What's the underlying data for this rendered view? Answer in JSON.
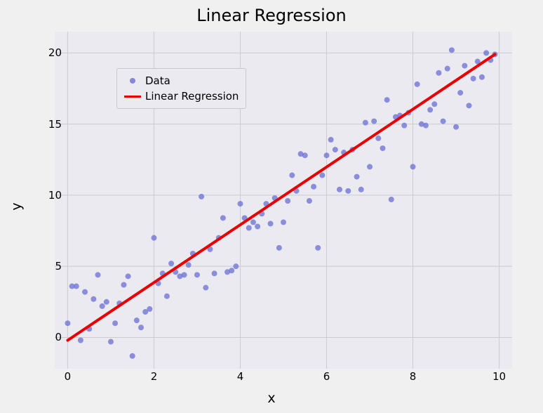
{
  "chart_data": {
    "type": "scatter",
    "title": "Linear Regression",
    "xlabel": "x",
    "ylabel": "y",
    "xlim": [
      -0.3,
      10.3
    ],
    "ylim": [
      -2.2,
      21.5
    ],
    "xticks": [
      0,
      2,
      4,
      6,
      8,
      10
    ],
    "yticks": [
      0,
      5,
      10,
      15,
      20
    ],
    "legend": [
      {
        "label": "Data",
        "type": "dot"
      },
      {
        "label": "Linear Regression",
        "type": "line"
      }
    ],
    "scatter": {
      "x": [
        0.0,
        0.1,
        0.2,
        0.3,
        0.4,
        0.5,
        0.6,
        0.7,
        0.8,
        0.9,
        1.0,
        1.1,
        1.2,
        1.3,
        1.4,
        1.5,
        1.6,
        1.7,
        1.8,
        1.9,
        2.0,
        2.1,
        2.2,
        2.3,
        2.4,
        2.5,
        2.6,
        2.7,
        2.8,
        2.9,
        3.0,
        3.1,
        3.2,
        3.3,
        3.4,
        3.5,
        3.6,
        3.7,
        3.8,
        3.9,
        4.0,
        4.1,
        4.2,
        4.3,
        4.4,
        4.5,
        4.6,
        4.7,
        4.8,
        4.9,
        5.0,
        5.1,
        5.2,
        5.3,
        5.4,
        5.5,
        5.6,
        5.7,
        5.8,
        5.9,
        6.0,
        6.1,
        6.2,
        6.3,
        6.4,
        6.5,
        6.6,
        6.7,
        6.8,
        6.9,
        7.0,
        7.1,
        7.2,
        7.3,
        7.4,
        7.5,
        7.6,
        7.7,
        7.8,
        7.9,
        8.0,
        8.1,
        8.2,
        8.3,
        8.4,
        8.5,
        8.6,
        8.7,
        8.8,
        8.9,
        9.0,
        9.1,
        9.2,
        9.3,
        9.4,
        9.5,
        9.6,
        9.7,
        9.8,
        9.9
      ],
      "y": [
        1.0,
        3.6,
        3.6,
        -0.2,
        3.2,
        0.6,
        2.7,
        4.4,
        2.2,
        2.5,
        -0.3,
        1.0,
        2.4,
        3.7,
        4.3,
        -1.3,
        1.2,
        0.7,
        1.8,
        2.0,
        7.0,
        3.8,
        4.5,
        2.9,
        5.2,
        4.6,
        4.3,
        4.4,
        5.1,
        5.9,
        4.4,
        9.9,
        3.5,
        6.2,
        4.5,
        7.0,
        8.4,
        4.6,
        4.7,
        5.0,
        9.4,
        8.4,
        7.7,
        8.1,
        7.8,
        8.7,
        9.4,
        8.0,
        9.8,
        6.3,
        8.1,
        9.6,
        11.4,
        10.3,
        12.9,
        12.8,
        9.6,
        10.6,
        6.3,
        11.4,
        12.8,
        13.9,
        13.2,
        10.4,
        13.0,
        10.3,
        13.2,
        11.3,
        10.4,
        15.1,
        12.0,
        15.2,
        14.0,
        13.3,
        16.7,
        9.7,
        15.5,
        15.6,
        14.9,
        15.8,
        12.0,
        17.8,
        15.0,
        14.9,
        16.0,
        16.4,
        18.6,
        15.2,
        18.9,
        20.2,
        14.8,
        17.2,
        19.1,
        16.3,
        18.2,
        19.4,
        18.3,
        20.0,
        19.5,
        19.9
      ]
    },
    "regression_line": {
      "x": [
        0.0,
        9.9
      ],
      "y": [
        -0.2,
        19.9
      ],
      "color": "#e80000"
    }
  }
}
